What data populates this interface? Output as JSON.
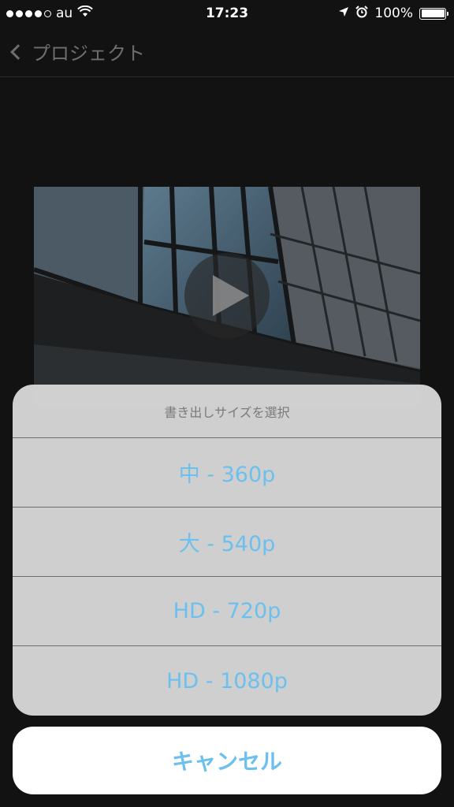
{
  "status_bar": {
    "carrier": "au",
    "time": "17:23",
    "battery_percent": "100%",
    "signal_bars_filled": 4,
    "signal_bars_total": 5,
    "battery_level": 1.0
  },
  "nav": {
    "back_label": "プロジェクト"
  },
  "action_sheet": {
    "title": "書き出しサイズを選択",
    "options": [
      {
        "label": "中 - 360p"
      },
      {
        "label": "大 - 540p"
      },
      {
        "label": "HD - 720p"
      },
      {
        "label": "HD - 1080p"
      }
    ],
    "cancel_label": "キャンセル"
  },
  "colors": {
    "accent": "#6cc0ee",
    "background": "#121212",
    "sheet_background": "#d6d6d6"
  }
}
